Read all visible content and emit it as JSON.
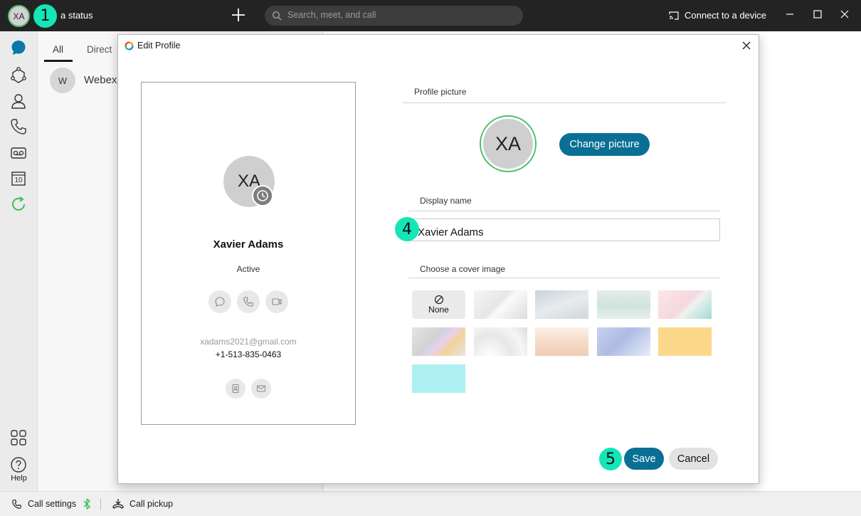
{
  "topbar": {
    "avatar_initials": "XA",
    "status_text": "a status",
    "search_placeholder": "Search, meet, and call",
    "connect_label": "Connect to a device"
  },
  "markers": {
    "m1": "1",
    "m4": "4",
    "m5": "5"
  },
  "rail": {
    "help_label": "Help",
    "calendar_day": "10"
  },
  "listpane": {
    "tabs": [
      {
        "label": "All"
      },
      {
        "label": "Direct"
      }
    ],
    "items": [
      {
        "initial": "W",
        "name": "Webex"
      }
    ]
  },
  "bottombar": {
    "call_settings": "Call settings",
    "call_pickup": "Call pickup"
  },
  "dialog": {
    "title": "Edit Profile",
    "card": {
      "initials": "XA",
      "name": "Xavier Adams",
      "status": "Active",
      "email": "xadams2021@gmail.com",
      "phone": "+1-513-835-0463"
    },
    "profile_picture_label": "Profile picture",
    "avatar_initials": "XA",
    "change_picture_label": "Change picture",
    "display_name_label": "Display name",
    "display_name_value": "Xavier Adams",
    "cover_label": "Choose a cover image",
    "cover_none_label": "None",
    "save_label": "Save",
    "cancel_label": "Cancel"
  },
  "colors": {
    "accent": "#0a6f94",
    "presence": "#4fbf6a",
    "marker": "#14e6b8",
    "topbar": "#232323"
  }
}
